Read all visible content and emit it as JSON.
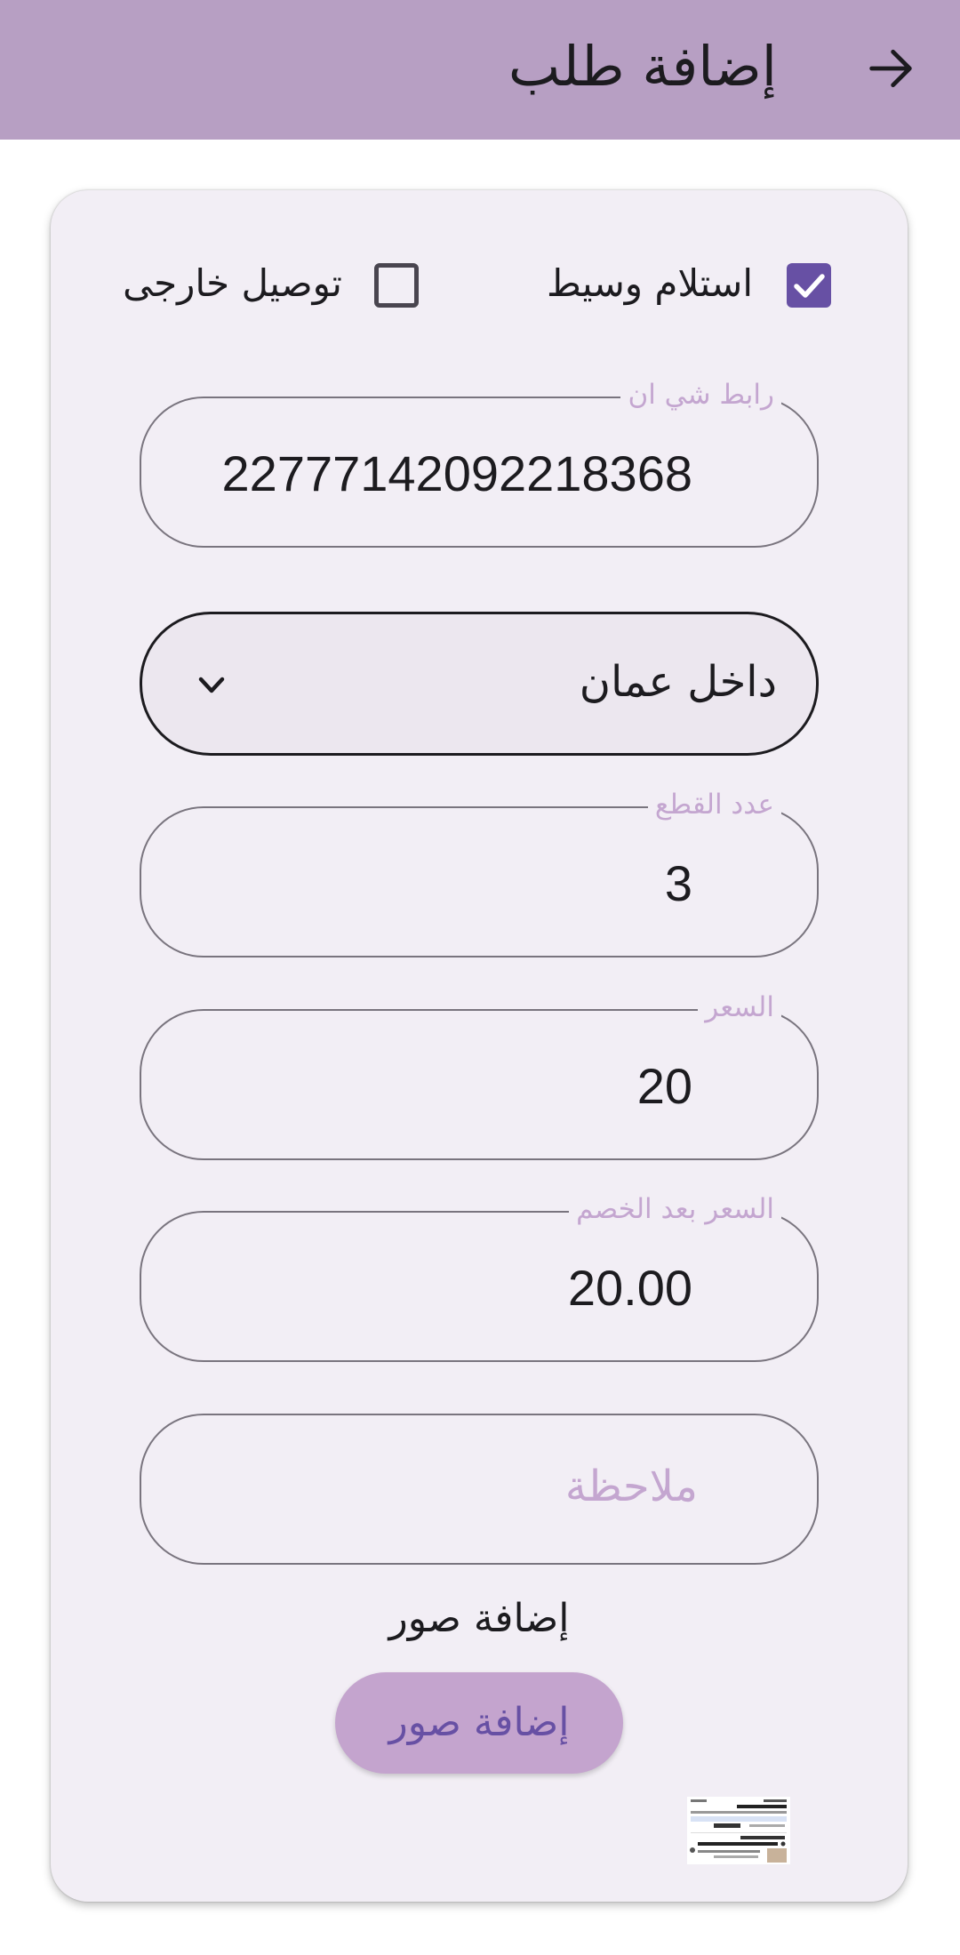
{
  "appbar": {
    "title": "إضافة طلب",
    "back_icon": "arrow-right-icon",
    "color": "#b79fc3"
  },
  "form": {
    "checkbox_pickup": {
      "label": "استلام وسيط",
      "checked": true
    },
    "checkbox_external": {
      "label": "توصيل خارجى",
      "checked": false
    },
    "link_field": {
      "label": "رابط شي ان",
      "value": "22777142092218368"
    },
    "region_dropdown": {
      "selected": "داخل عمان",
      "icon": "chevron-down-icon"
    },
    "pieces_field": {
      "label": "عدد القطع",
      "value": "3"
    },
    "price_field": {
      "label": "السعر",
      "value": "20"
    },
    "discount_price_field": {
      "label": "السعر بعد الخصم",
      "value": "20.00"
    },
    "note_field": {
      "placeholder": "ملاحظة",
      "value": ""
    },
    "images_section_title": "إضافة صور",
    "add_images_button": "إضافة صور",
    "accent_color": "#6750a4"
  }
}
